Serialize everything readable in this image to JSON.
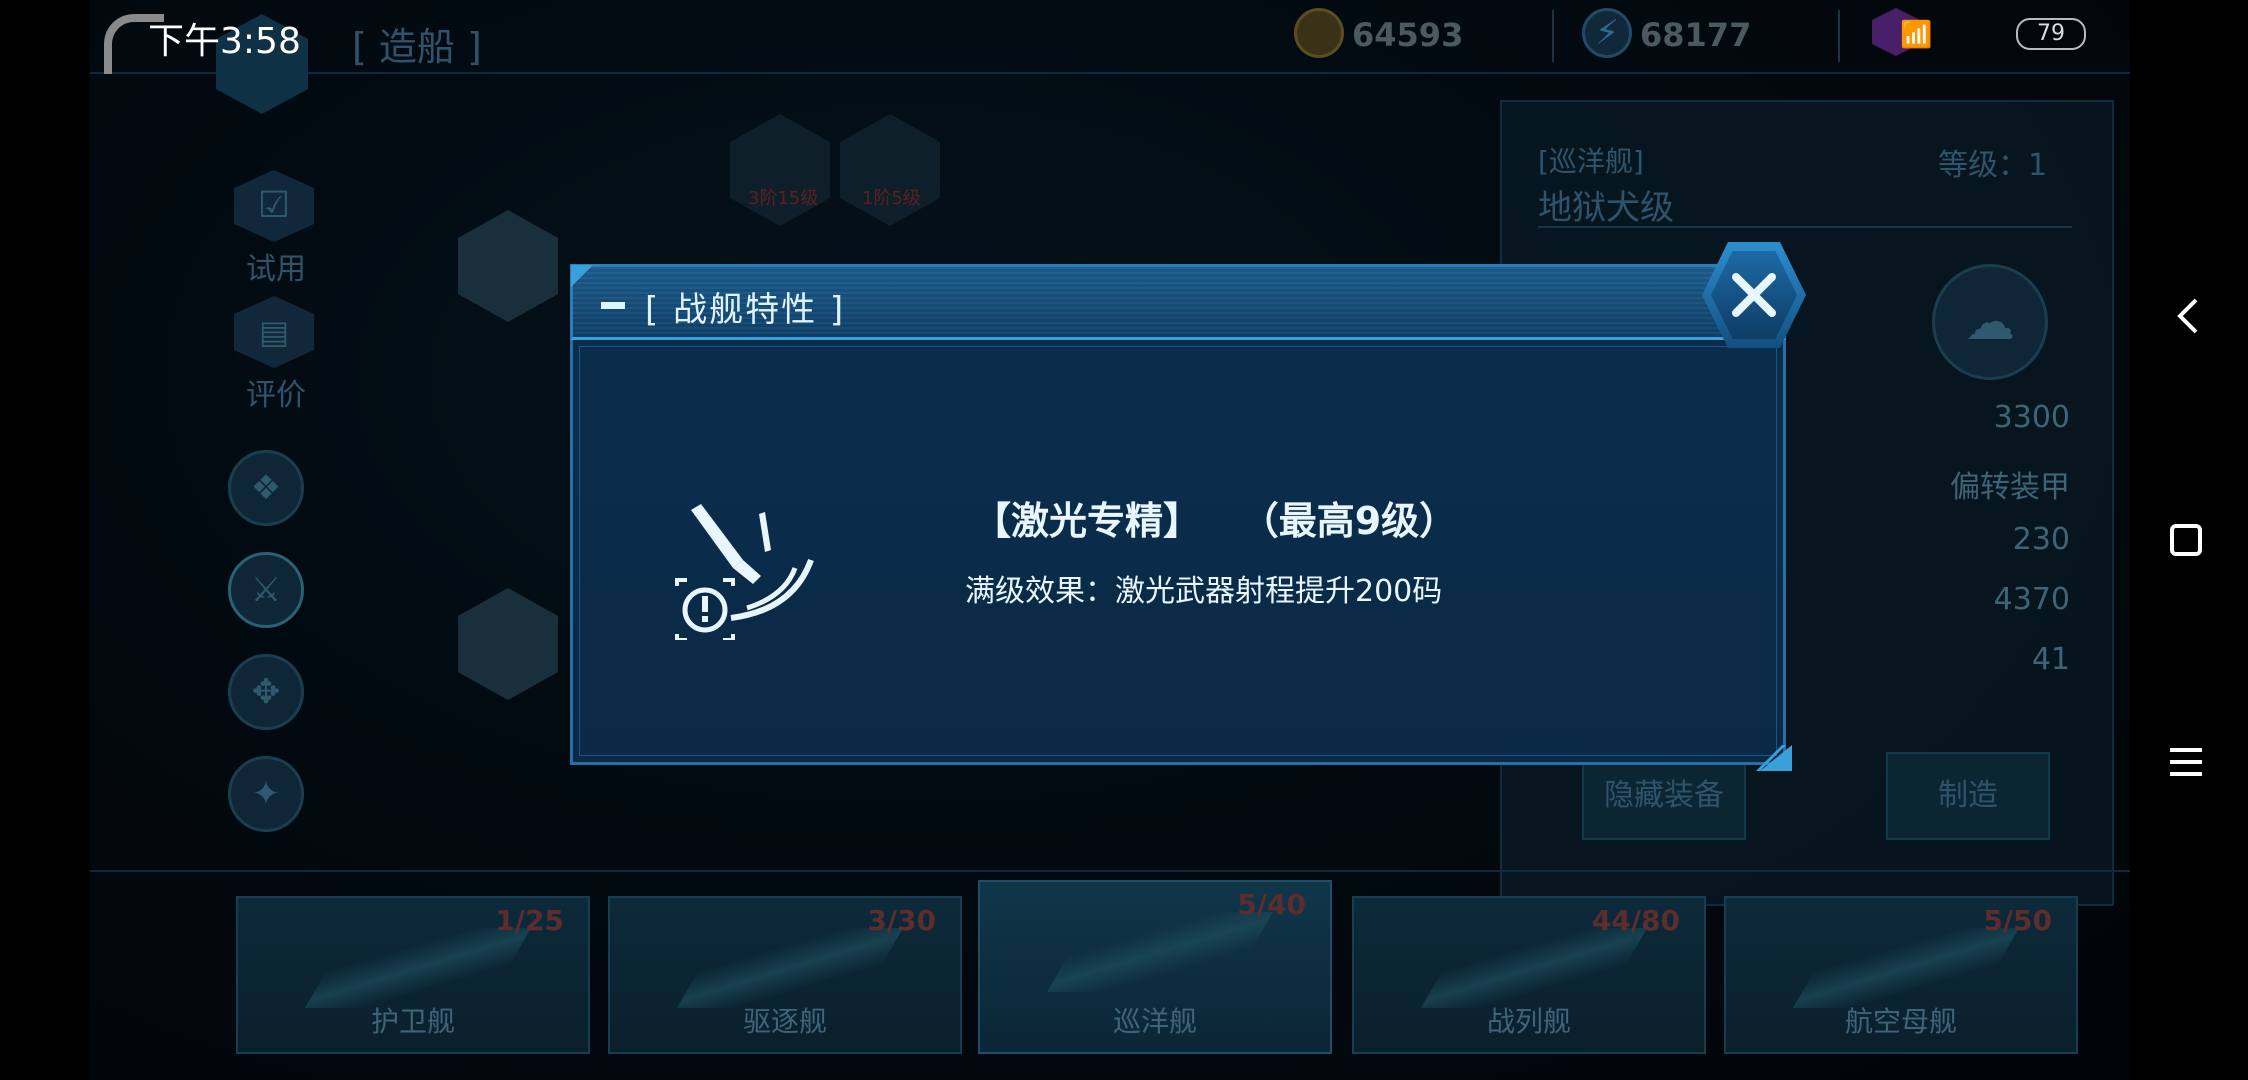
{
  "status_bar": {
    "time": "下午3:58",
    "battery": "79"
  },
  "header": {
    "title": "[ 造船 ]",
    "coins": "64593",
    "energy": "68177"
  },
  "left_menu": {
    "trial_label": "试用",
    "review_label": "评价"
  },
  "hex_locks": {
    "lock1": "3阶15级",
    "lock2": "1阶5级"
  },
  "ship_panel": {
    "type": "[巡洋舰]",
    "level": "等级：1",
    "name": "地狱犬级",
    "stats": [
      "3300",
      "偏转装甲",
      "230",
      "4370",
      "41"
    ],
    "hide_equipment": "隐藏装备",
    "build": "制造"
  },
  "tabs": [
    {
      "name": "护卫舰",
      "count": "1/25"
    },
    {
      "name": "驱逐舰",
      "count": "3/30"
    },
    {
      "name": "巡洋舰",
      "count": "5/40"
    },
    {
      "name": "战列舰",
      "count": "44/80"
    },
    {
      "name": "航空母舰",
      "count": "5/50"
    }
  ],
  "modal": {
    "title": "[ 战舰特性 ]",
    "skill_name": "【激光专精】   （最高9级）",
    "skill_effect": "满级效果：激光武器射程提升200码",
    "close_icon": "close-x-icon",
    "skill_icon": "laser-sword-target-icon"
  },
  "colors": {
    "accent": "#2a7fb8",
    "modal_bg": "#0b2d4c",
    "text": "#e8f6ff"
  }
}
